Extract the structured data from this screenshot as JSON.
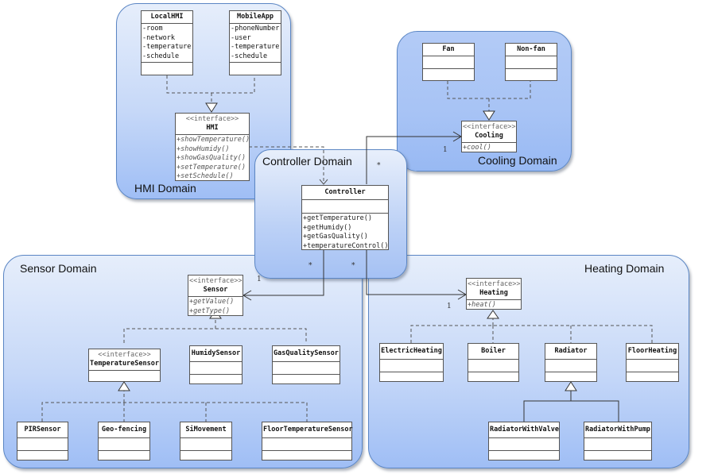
{
  "domains": {
    "hmi": {
      "label": "HMI Domain"
    },
    "cooling": {
      "label": "Cooling Domain"
    },
    "controller": {
      "label": "Controller Domain"
    },
    "sensor": {
      "label": "Sensor Domain"
    },
    "heating": {
      "label": "Heating Domain"
    }
  },
  "classes": {
    "local_hmi": {
      "name": "LocalHMI",
      "attributes": [
        "-room",
        "-network",
        "-temperature",
        "-schedule"
      ]
    },
    "mobile_app": {
      "name": "MobileApp",
      "attributes": [
        "-phoneNumber",
        "-user",
        "-temperature",
        "-schedule"
      ]
    },
    "hmi": {
      "stereotype": "<<interface>>",
      "name": "HMI",
      "operations": [
        "+showTemperature()",
        "+showHumidy()",
        "+showGasQuality()",
        "+setTemperature()",
        "+setSchedule()"
      ]
    },
    "fan": {
      "name": "Fan"
    },
    "non_fan": {
      "name": "Non-fan"
    },
    "cooling": {
      "stereotype": "<<interface>>",
      "name": "Cooling",
      "operations": [
        "+cool()"
      ]
    },
    "controller": {
      "name": "Controller",
      "operations": [
        "+getTemperature()",
        "+getHumidy()",
        "+getGasQuality()",
        "+temperatureControl()"
      ]
    },
    "sensor": {
      "stereotype": "<<interface>>",
      "name": "Sensor",
      "operations": [
        "+getValue()",
        "+getType()"
      ]
    },
    "temperature_sensor": {
      "stereotype": "<<interface>>",
      "name": "TemperatureSensor"
    },
    "humidy_sensor": {
      "name": "HumidySensor"
    },
    "gas_quality_sensor": {
      "name": "GasQualitySensor"
    },
    "pir_sensor": {
      "name": "PIRSensor"
    },
    "geo_fencing": {
      "name": "Geo-fencing"
    },
    "si_movement": {
      "name": "SiMovement"
    },
    "floor_temperature_sensor": {
      "name": "FloorTemperatureSensor"
    },
    "heating": {
      "stereotype": "<<interface>>",
      "name": "Heating",
      "operations": [
        "+heat()"
      ]
    },
    "electric_heating": {
      "name": "ElectricHeating"
    },
    "boiler": {
      "name": "Boiler"
    },
    "radiator": {
      "name": "Radiator"
    },
    "floor_heating": {
      "name": "FloorHeating"
    },
    "radiator_with_valve": {
      "name": "RadiatorWithValve"
    },
    "radiator_with_pump": {
      "name": "RadiatorWithPump"
    }
  },
  "multiplicities": {
    "cooling_one": "1",
    "cooling_many": "*",
    "sensor_one": "1",
    "sensor_many": "*",
    "heating_one": "1",
    "heating_many": "*"
  }
}
